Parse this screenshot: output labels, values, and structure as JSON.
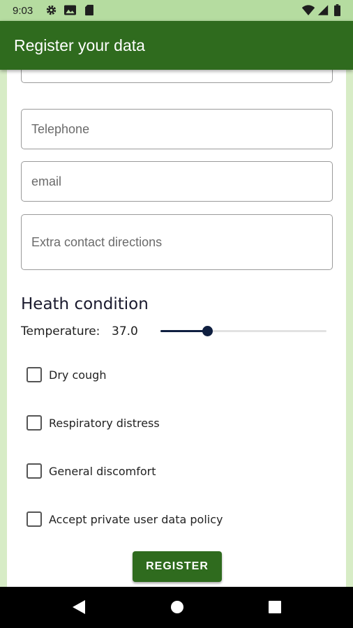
{
  "status_bar": {
    "time": "9:03",
    "icons": [
      "gear-icon",
      "photo-icon",
      "sd-card-icon",
      "wifi-icon",
      "signal-icon",
      "battery-icon"
    ]
  },
  "app_bar": {
    "title": "Register your data"
  },
  "contact": {
    "telephone_placeholder": "Telephone",
    "email_placeholder": "email",
    "extra_placeholder": "Extra contact directions"
  },
  "health": {
    "title": "Heath condition",
    "temperature_label": "Temperature:",
    "temperature_value": "37.0",
    "slider_fraction": 0.28,
    "checkboxes": [
      {
        "label": "Dry cough",
        "checked": false
      },
      {
        "label": "Respiratory distress",
        "checked": false
      },
      {
        "label": "General discomfort",
        "checked": false
      },
      {
        "label": "Accept private user data policy",
        "checked": false
      }
    ],
    "register_label": "REGISTER"
  },
  "nav_bar": {
    "icons": [
      "back-icon",
      "home-icon",
      "recents-icon"
    ]
  },
  "colors": {
    "primary": "#2f6b1e",
    "status_bar": "#b5dca0",
    "background": "#d7ecc6",
    "slider": "#0f1f40"
  }
}
